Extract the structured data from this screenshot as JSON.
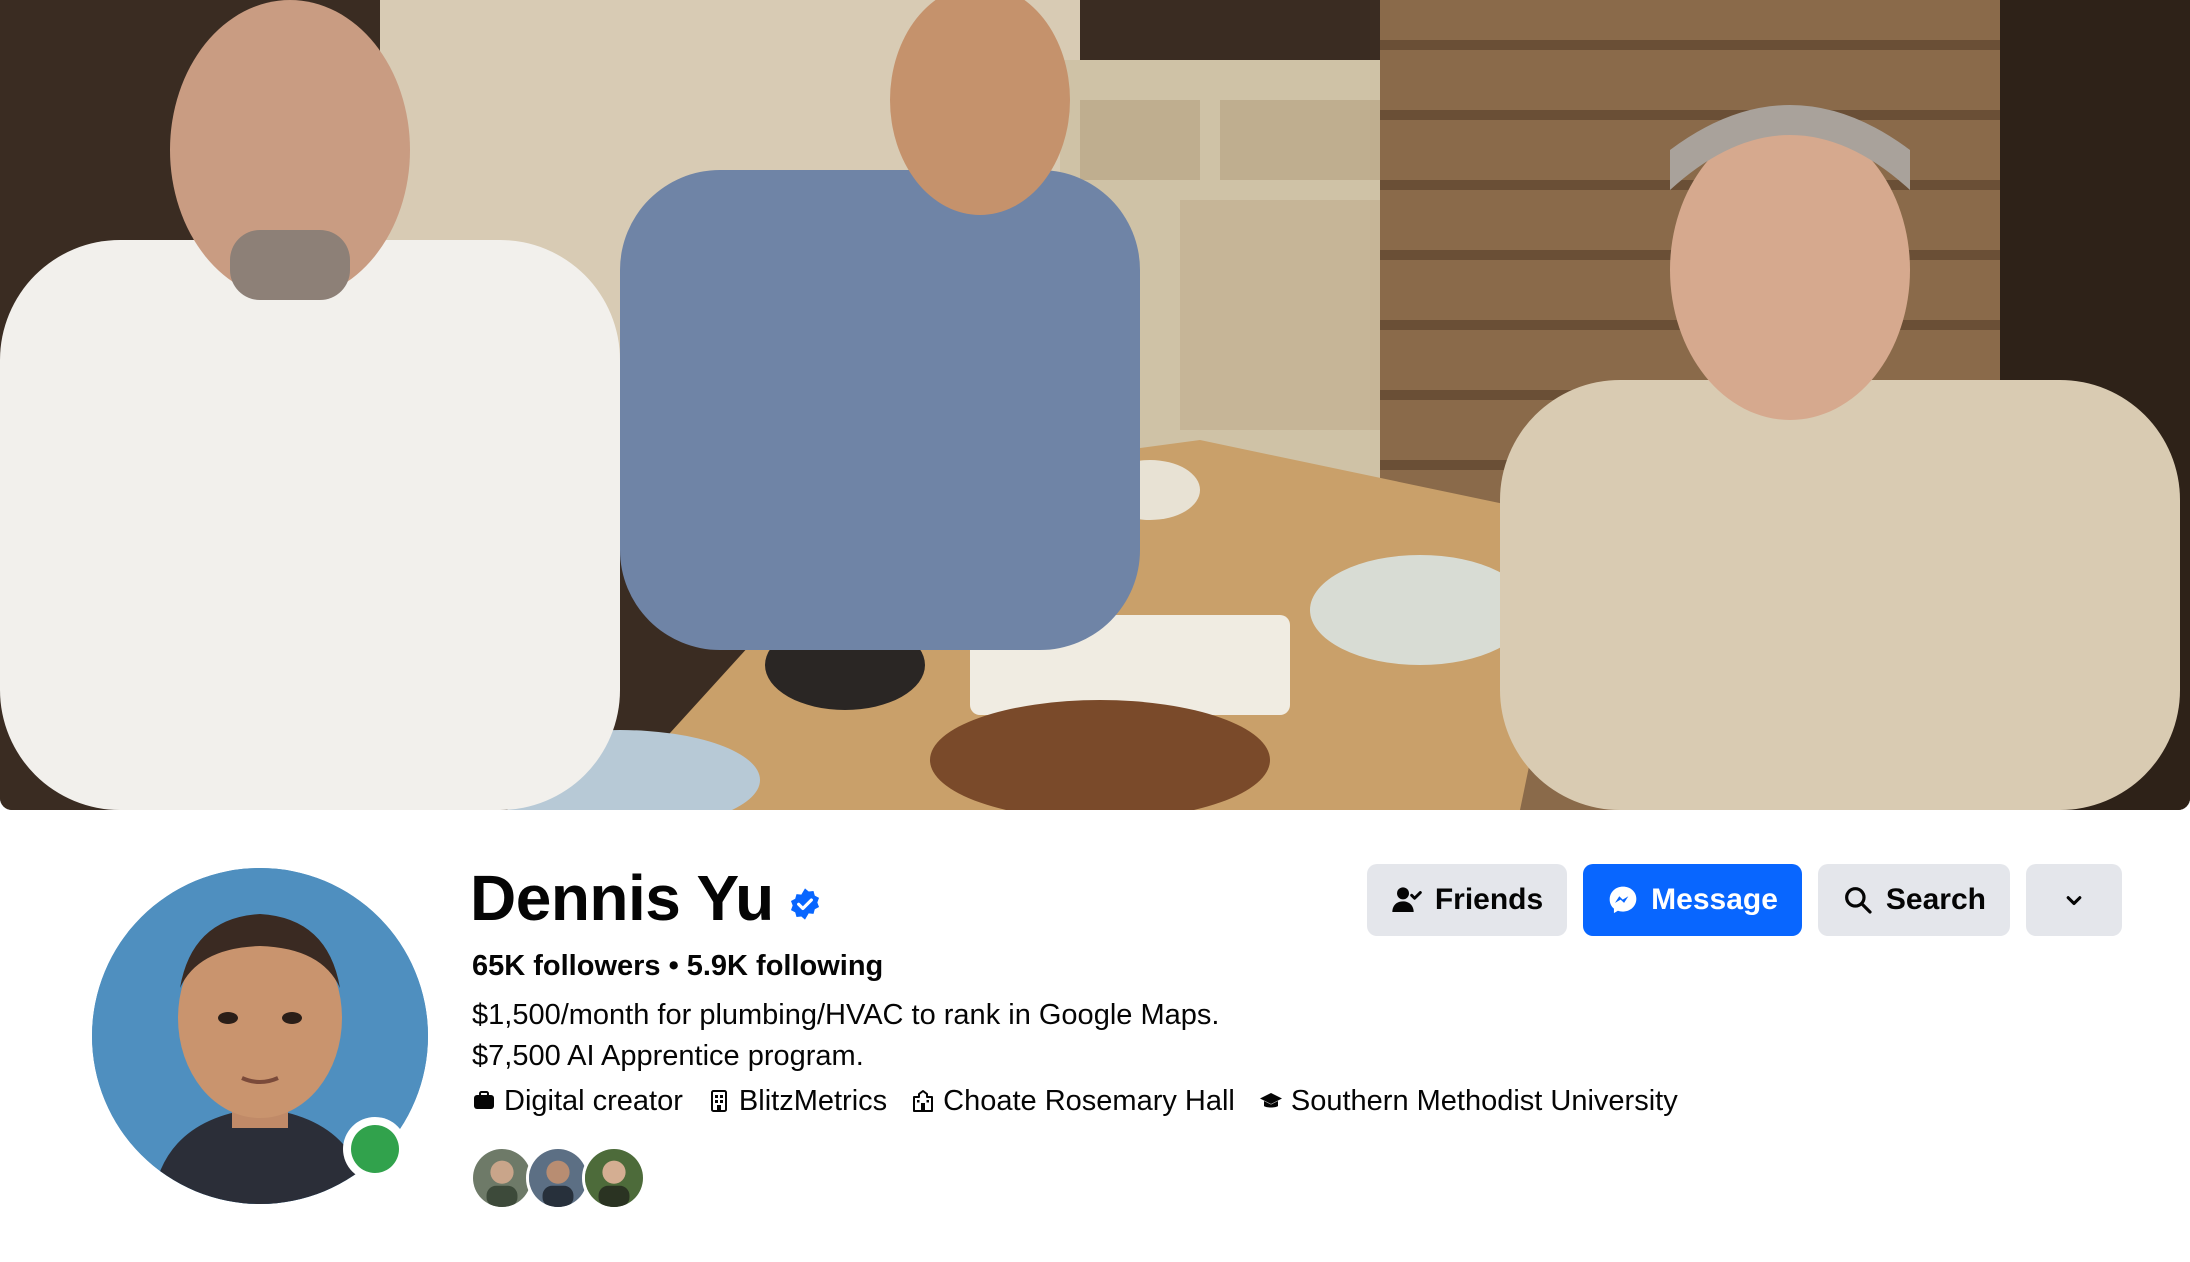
{
  "profile": {
    "name": "Dennis Yu",
    "followers": "65K followers",
    "separator": "•",
    "following": "5.9K following",
    "bio_line1": "$1,500/month for plumbing/HVAC to rank in Google Maps.",
    "bio_line2": "$7,500 AI Apprentice program.",
    "details": [
      {
        "icon": "briefcase-icon",
        "label": "Digital creator"
      },
      {
        "icon": "building-icon",
        "label": "BlitzMetrics"
      },
      {
        "icon": "school-icon",
        "label": "Choate Rosemary Hall"
      },
      {
        "icon": "graduation-cap-icon",
        "label": "Southern Methodist University"
      }
    ]
  },
  "actions": {
    "friends_label": "Friends",
    "message_label": "Message",
    "search_label": "Search"
  },
  "colors": {
    "primary": "#0866ff",
    "button_bg": "#e4e6eb",
    "online": "#31a24c",
    "verified": "#0866ff"
  }
}
